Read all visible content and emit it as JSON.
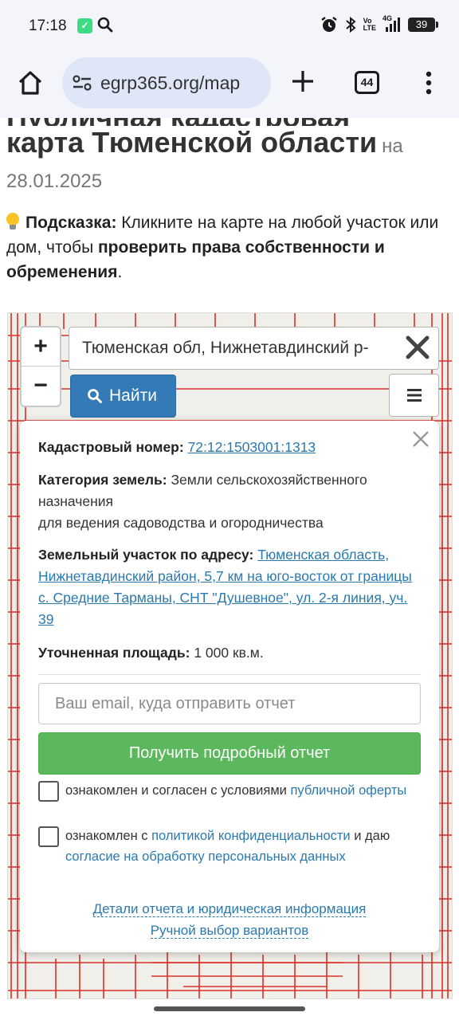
{
  "status_bar": {
    "time": "17:18",
    "network_volte": "Vo",
    "network_lte": "LTE",
    "network_type": "4G",
    "battery": "39"
  },
  "browser": {
    "url": "egrp365.org/map",
    "tab_count": "44"
  },
  "page": {
    "heading": "карта Тюменской области",
    "heading_on": "на",
    "heading_cut": "Публичная кадастровая",
    "date": "28.01.2025",
    "hint_label": "Подсказка:",
    "hint_text": " Кликните на карте на любой участок или дом, чтобы ",
    "hint_bold": "проверить права собственности и обременения",
    "hint_end": "."
  },
  "map": {
    "zoom_in": "+",
    "zoom_out": "−",
    "search_value": "Тюменская обл, Нижнетавдинский р-",
    "find_label": "Найти",
    "colors": {
      "plot_border": "#d9302a",
      "map_bg": "#f1efe9"
    }
  },
  "popup": {
    "cadastral_label": "Кадастровый номер:",
    "cadastral_value": "72:12:1503001:1313",
    "category_label": "Категория земель:",
    "category_value": "Земли сельскохозяйственного назначения",
    "usage": "для ведения садоводства и огородничества",
    "address_label": "Земельный участок по адресу:",
    "address_value": "Тюменская область, Нижнетавдинский район, 5,7 км на юго-восток от границы с. Средние Тарманы, СНТ \"Душевное\", ул. 2-я линия, уч. 39",
    "area_label": "Уточненная площадь:",
    "area_value": "1 000 кв.м.",
    "email_placeholder": "Ваш email, куда отправить отчет",
    "report_button": "Получить подробный отчет",
    "terms_text": "ознакомлен и согласен с условиями ",
    "terms_link": "публичной оферты",
    "privacy_text": "ознакомлен с ",
    "privacy_link": "политикой конфиденциальности",
    "privacy_mid": " и даю ",
    "consent_link": "согласие на обработку персональных данных",
    "details_link": "Детали отчета и юридическая информация",
    "manual_link": "Ручной выбор вариантов"
  }
}
